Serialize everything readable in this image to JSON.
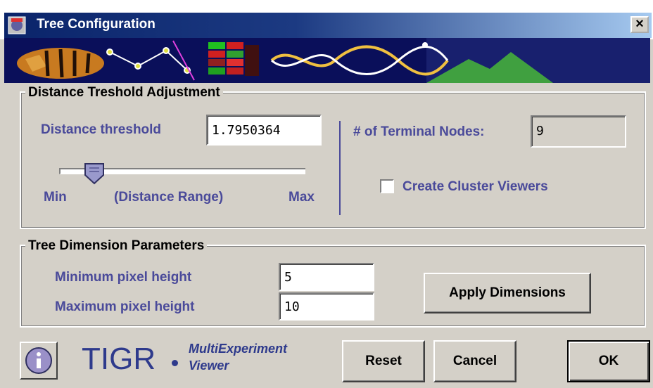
{
  "window": {
    "title": "Tree Configuration",
    "close_glyph": "×"
  },
  "distance_group": {
    "title": "Distance Treshold Adjustment",
    "threshold_label": "Distance threshold",
    "threshold_value": "1.7950364",
    "slider_min_label": "Min",
    "slider_range_label": "(Distance Range)",
    "slider_max_label": "Max",
    "slider_position_fraction": 0.12,
    "terminal_nodes_label": "# of Terminal Nodes:",
    "terminal_nodes_value": "9",
    "cluster_viewers_label": "Create Cluster Viewers",
    "cluster_viewers_checked": false
  },
  "dimension_group": {
    "title": "Tree Dimension Parameters",
    "min_height_label": "Minimum pixel height",
    "min_height_value": "5",
    "max_height_label": "Maximum pixel height",
    "max_height_value": "10",
    "apply_label": "Apply Dimensions"
  },
  "footer": {
    "info_icon": "info-icon",
    "logo_text": "TIGR",
    "logo_sub1": "MultiExperiment",
    "logo_sub2": "Viewer",
    "reset_label": "Reset",
    "cancel_label": "Cancel",
    "ok_label": "OK"
  },
  "colors": {
    "title_bar": "#0a246a",
    "label_text": "#4a4a9a",
    "face": "#d4d0c8"
  }
}
